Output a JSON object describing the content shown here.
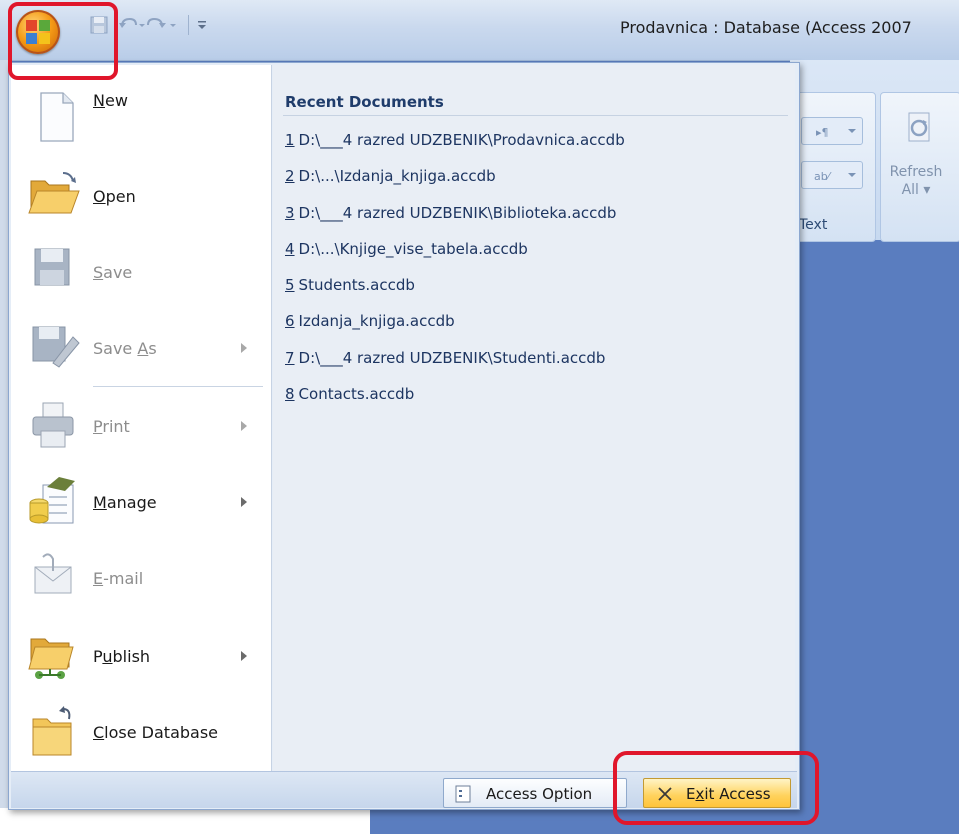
{
  "window": {
    "title": "Prodavnica : Database (Access 2007"
  },
  "ribbon": {
    "text_group_label": "Text",
    "refresh_label": "Refresh",
    "refresh_sub": "All ▾"
  },
  "menu": {
    "items": [
      {
        "label_pre": "",
        "accel": "N",
        "label_post": "ew",
        "enabled": true,
        "submenu": false,
        "icon": "new-document-icon"
      },
      {
        "label_pre": "",
        "accel": "O",
        "label_post": "pen",
        "enabled": true,
        "submenu": false,
        "icon": "open-folder-icon"
      },
      {
        "label_pre": "",
        "accel": "S",
        "label_post": "ave",
        "enabled": false,
        "submenu": false,
        "icon": "save-disk-icon"
      },
      {
        "label_pre": "Save ",
        "accel": "A",
        "label_post": "s",
        "enabled": false,
        "submenu": true,
        "icon": "save-as-icon"
      },
      {
        "label_pre": "",
        "accel": "P",
        "label_post": "rint",
        "enabled": false,
        "submenu": true,
        "icon": "printer-icon"
      },
      {
        "label_pre": "",
        "accel": "M",
        "label_post": "anage",
        "enabled": true,
        "submenu": true,
        "icon": "manage-database-icon"
      },
      {
        "label_pre": "",
        "accel": "E",
        "label_post": "-mail",
        "enabled": false,
        "submenu": false,
        "icon": "email-icon"
      },
      {
        "label_pre": "P",
        "accel": "u",
        "label_post": "blish",
        "enabled": true,
        "submenu": true,
        "icon": "publish-icon"
      },
      {
        "label_pre": "",
        "accel": "C",
        "label_post": "lose Database",
        "enabled": true,
        "submenu": false,
        "icon": "close-database-icon"
      }
    ],
    "recent_title": "Recent Documents",
    "recent": [
      {
        "num": "1",
        "path": "D:\\___4 razred UDZBENIK\\Prodavnica.accdb"
      },
      {
        "num": "2",
        "path": "D:\\...\\Izdanja_knjiga.accdb"
      },
      {
        "num": "3",
        "path": "D:\\___4 razred UDZBENIK\\Biblioteka.accdb"
      },
      {
        "num": "4",
        "path": "D:\\...\\Knjige_vise_tabela.accdb"
      },
      {
        "num": "5",
        "path": "Students.accdb"
      },
      {
        "num": "6",
        "path": "Izdanja_knjiga.accdb"
      },
      {
        "num": "7",
        "path": "D:\\___4 razred UDZBENIK\\Studenti.accdb"
      },
      {
        "num": "8",
        "path": "Contacts.accdb"
      }
    ],
    "options_button": "Access Option",
    "exit_button_pre": "E",
    "exit_button_accel": "x",
    "exit_button_post": "it Access"
  },
  "colors": {
    "highlight": "#e0162b",
    "workspace": "#5a7dbf"
  }
}
